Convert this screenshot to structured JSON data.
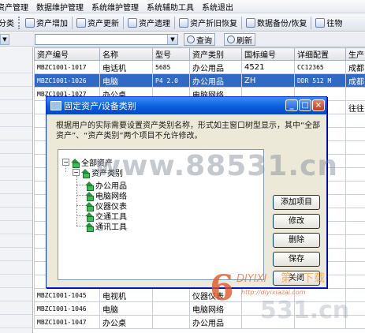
{
  "menu": [
    "资产管理",
    "数据维护管理",
    "系统维护管理",
    "系统辅助工具",
    "系统退出"
  ],
  "toolbar": {
    "left_fragment": "分类",
    "buttons": [
      "资产增加",
      "资产更新",
      "资产遗理",
      "资产折旧恢复",
      "数据备份/恢复",
      "往物"
    ]
  },
  "search": {
    "query_label": "查询",
    "refresh_label": "刷新"
  },
  "grid": {
    "columns": [
      "资产编号",
      "名称",
      "型号",
      "资产类别",
      "国标编号",
      "详细配置",
      "生产"
    ],
    "rows": [
      {
        "code": "MBZC1001-1017",
        "name": "电话机",
        "model": "5685",
        "category": "办公用品",
        "gb": "4521",
        "config": "CC12365",
        "maker": "成都",
        "selected": false
      },
      {
        "code": "MBZC1001-1026",
        "name": "电脑",
        "model": "P4 2.0",
        "category": "办公用品",
        "gb": "ZH",
        "config": "DDR 512 M",
        "maker": "成都",
        "selected": true
      },
      {
        "code": "MBZC1001-1027",
        "name": "办公桌",
        "model": "",
        "category": "电脑网络",
        "gb": "",
        "config": "",
        "maker": "",
        "selected": false
      },
      {
        "code": "",
        "name": "",
        "model": "",
        "category": "",
        "gb": "",
        "config": "",
        "maker": "往往",
        "selected": false
      },
      {
        "code": "",
        "name": "",
        "model": "",
        "category": "",
        "gb": "",
        "config": "",
        "maker": "",
        "selected": false
      },
      {
        "code": "",
        "name": "",
        "model": "",
        "category": "",
        "gb": "",
        "config": "",
        "maker": "",
        "selected": false
      },
      {
        "code": "",
        "name": "",
        "model": "",
        "category": "",
        "gb": "",
        "config": "",
        "maker": "",
        "selected": false
      },
      {
        "code": "",
        "name": "",
        "model": "",
        "category": "",
        "gb": "",
        "config": "",
        "maker": "",
        "selected": false
      },
      {
        "code": "",
        "name": "",
        "model": "",
        "category": "",
        "gb": "",
        "config": "",
        "maker": "",
        "selected": false
      },
      {
        "code": "",
        "name": "",
        "model": "",
        "category": "",
        "gb": "",
        "config": "",
        "maker": "",
        "selected": false
      },
      {
        "code": "",
        "name": "",
        "model": "",
        "category": "",
        "gb": "",
        "config": "",
        "maker": "",
        "selected": false
      },
      {
        "code": "",
        "name": "",
        "model": "",
        "category": "",
        "gb": "",
        "config": "",
        "maker": "",
        "selected": false
      },
      {
        "code": "",
        "name": "",
        "model": "",
        "category": "",
        "gb": "",
        "config": "",
        "maker": "",
        "selected": false
      },
      {
        "code": "",
        "name": "",
        "model": "",
        "category": "",
        "gb": "",
        "config": "",
        "maker": "",
        "selected": false
      },
      {
        "code": "",
        "name": "",
        "model": "",
        "category": "",
        "gb": "",
        "config": "",
        "maker": "",
        "selected": false
      },
      {
        "code": "",
        "name": "",
        "model": "",
        "category": "",
        "gb": "",
        "config": "",
        "maker": "",
        "selected": false
      },
      {
        "code": "",
        "name": "",
        "model": "",
        "category": "电脑网络",
        "gb": "",
        "config": "",
        "maker": "",
        "selected": false
      },
      {
        "code": "MBZC1001-1045",
        "name": "电视机",
        "model": "",
        "category": "仪器仪表",
        "gb": "",
        "config": "",
        "maker": "",
        "selected": false
      },
      {
        "code": "MBZC1001-1046",
        "name": "电脑",
        "model": "",
        "category": "电脑网络",
        "gb": "",
        "config": "",
        "maker": "",
        "selected": false
      },
      {
        "code": "MBZC1001-1047",
        "name": "办公桌",
        "model": "",
        "category": "办公用品",
        "gb": "",
        "config": "",
        "maker": "",
        "selected": false
      }
    ]
  },
  "dialog": {
    "title": "固定资产/设备类别",
    "description": "根据用户的实际需要设置资产类别名称，形式如主窗口树型显示，其中“全部资产”、“资产类别”两个项目不允许修改。",
    "tree": {
      "root": "全部资产",
      "child": "资产类别",
      "leaves": [
        "办公用品",
        "电脑网络",
        "仪器仪表",
        "交通工具",
        "通讯工具"
      ]
    },
    "buttons": {
      "add": "添加项目",
      "edit": "修改",
      "delete": "删除",
      "save": "保存",
      "close": "关闭"
    }
  },
  "watermarks": {
    "url_main": "www.88531.cn",
    "url_corner": "531.cn",
    "logo_number": "6",
    "logo_brand": "DIYIXI",
    "logo_cn": "第一下载",
    "logo_site": "http://diyixiazai.com"
  },
  "colors": {
    "selection": "#316ac5",
    "dialog_title": "#0a5fdc",
    "tree_icon": "#3bbf54"
  }
}
